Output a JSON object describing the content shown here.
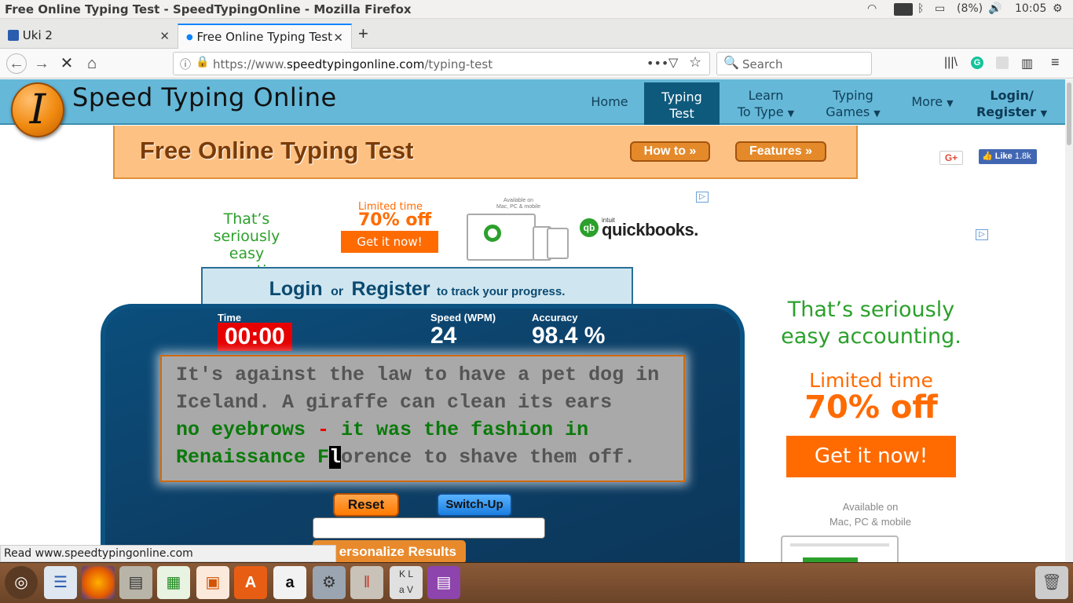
{
  "system": {
    "window_title": "Free Online Typing Test - SpeedTypingOnline - Mozilla Firefox",
    "keyboard": "En",
    "battery": "(8%)",
    "clock": "10:05"
  },
  "tabs": [
    {
      "label": "Uki 2"
    },
    {
      "label": "Free Online Typing Test"
    }
  ],
  "nav": {
    "url_prefix": "https://www.",
    "url_domain": "speedtypingonline.com",
    "url_path": "/typing-test",
    "search_placeholder": "Search"
  },
  "site": {
    "name": "Speed Typing Online",
    "logo_letter": "I",
    "menu": [
      {
        "line1": "Home",
        "line2": ""
      },
      {
        "line1": "Typing",
        "line2": "Test"
      },
      {
        "line1": "Learn",
        "line2": "To Type"
      },
      {
        "line1": "Typing",
        "line2": "Games"
      },
      {
        "line1": "More",
        "line2": ""
      },
      {
        "line1": "Login/",
        "line2": "Register"
      }
    ],
    "banner_title": "Free Online Typing Test",
    "how_to": "How to »",
    "features": "Features »",
    "gplus": "G+",
    "like": "Like",
    "like_count": "1.8k"
  },
  "ad_top": {
    "tagline1": "That’s seriously",
    "tagline2": "easy accounting.",
    "limited": "Limited time",
    "offer": "70% off",
    "cta": "Get it now!",
    "available": "Available on",
    "platforms": "Mac, PC & mobile",
    "brand_prefix": "intuit",
    "brand": "quickbooks."
  },
  "ad_side": {
    "tagline1": "That’s seriously",
    "tagline2": "easy accounting.",
    "limited": "Limited time",
    "offer": "70% off",
    "cta": "Get it now!",
    "available": "Available on",
    "platforms": "Mac, PC & mobile"
  },
  "login_panel": {
    "login": "Login",
    "or": "or",
    "register": "Register",
    "suffix": "to track your progress."
  },
  "test": {
    "time_label": "Time",
    "time_value": "00:00",
    "speed_label": "Speed (WPM)",
    "speed_value": "24",
    "accuracy_label": "Accuracy",
    "accuracy_value": "98.4 %",
    "line1": "It's against the law to have a pet dog in",
    "line2": "Iceland. A giraffe can clean its ears",
    "line3_a": "no eyebrows ",
    "line3_err": "-",
    "line3_b": " it was the fashion in",
    "line4_done": "Renaissance F",
    "line4_cursor": "l",
    "line4_rest": "orence to shave them off.",
    "reset": "Reset",
    "switch_up": "Switch-Up",
    "personalize": "ersonalize Results"
  },
  "status_bar": "Read www.speedtypingonline.com",
  "colors": {
    "header": "#65b8d8",
    "banner": "#fdc283",
    "timer": "#e60000",
    "ad_green": "#2ca02c",
    "ad_orange": "#ff6b00"
  }
}
